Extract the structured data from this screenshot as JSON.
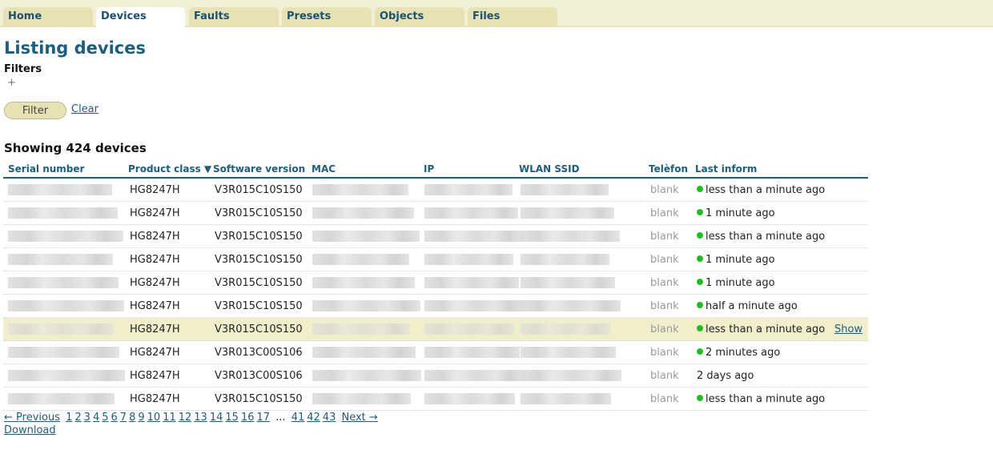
{
  "nav": {
    "tabs": [
      {
        "label": "Home"
      },
      {
        "label": "Devices"
      },
      {
        "label": "Faults"
      },
      {
        "label": "Presets"
      },
      {
        "label": "Objects"
      },
      {
        "label": "Files"
      }
    ],
    "active": "Devices"
  },
  "page": {
    "title": "Listing devices",
    "filters_label": "Filters",
    "add_filter_icon": "+",
    "filter_button": "Filter",
    "clear_link": "Clear",
    "showing": "Showing 424 devices"
  },
  "table": {
    "columns": [
      {
        "label": "Serial number"
      },
      {
        "label": "Product class ▼"
      },
      {
        "label": "Software version"
      },
      {
        "label": "MAC"
      },
      {
        "label": "IP"
      },
      {
        "label": "WLAN SSID"
      },
      {
        "label": "Telèfon"
      },
      {
        "label": "Last inform"
      }
    ],
    "rows": [
      {
        "product": "HG8247H",
        "software": "V3R015C10S150",
        "telefon": "blank",
        "online": true,
        "last_inform": "less than a minute ago"
      },
      {
        "product": "HG8247H",
        "software": "V3R015C10S150",
        "telefon": "blank",
        "online": true,
        "last_inform": "1 minute ago"
      },
      {
        "product": "HG8247H",
        "software": "V3R015C10S150",
        "telefon": "blank",
        "online": true,
        "last_inform": "less than a minute ago"
      },
      {
        "product": "HG8247H",
        "software": "V3R015C10S150",
        "telefon": "blank",
        "online": true,
        "last_inform": "1 minute ago"
      },
      {
        "product": "HG8247H",
        "software": "V3R015C10S150",
        "telefon": "blank",
        "online": true,
        "last_inform": "1 minute ago"
      },
      {
        "product": "HG8247H",
        "software": "V3R015C10S150",
        "telefon": "blank",
        "online": true,
        "last_inform": "half a minute ago"
      },
      {
        "product": "HG8247H",
        "software": "V3R015C10S150",
        "telefon": "blank",
        "online": true,
        "last_inform": "less than a minute ago",
        "highlighted": true,
        "show_label": "Show"
      },
      {
        "product": "HG8247H",
        "software": "V3R013C00S106",
        "telefon": "blank",
        "online": true,
        "last_inform": "2 minutes ago"
      },
      {
        "product": "HG8247H",
        "software": "V3R013C00S106",
        "telefon": "blank",
        "online": false,
        "last_inform": "2 days ago"
      },
      {
        "product": "HG8247H",
        "software": "V3R015C10S150",
        "telefon": "blank",
        "online": true,
        "last_inform": "less than a minute ago"
      }
    ],
    "status_color_online": "#1fbf1f"
  },
  "pagination": {
    "previous": "← Previous",
    "pages": [
      "1",
      "2",
      "3",
      "4",
      "5",
      "6",
      "7",
      "8",
      "9",
      "10",
      "11",
      "12",
      "13",
      "14",
      "15",
      "16",
      "17"
    ],
    "ellipsis": "...",
    "tail_pages": [
      "41",
      "42",
      "43"
    ],
    "next": "Next →"
  },
  "download_label": "Download",
  "colors": {
    "accent": "#1b5e7e",
    "nav_bg": "#f2f0d4",
    "tab_bg": "#e6e2b3",
    "highlight_row": "#f0eecb"
  }
}
